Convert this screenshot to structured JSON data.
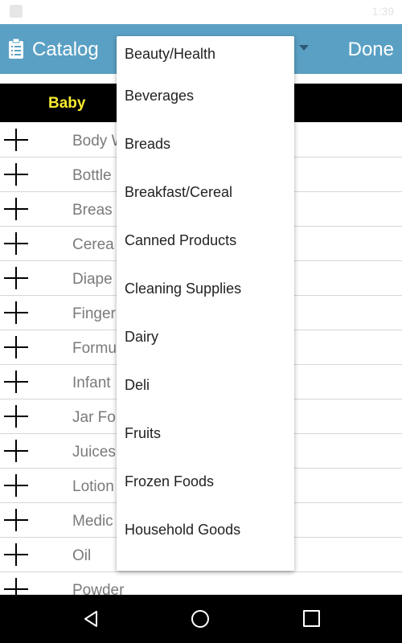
{
  "status_bar": {
    "right_text": "1:39"
  },
  "app_bar": {
    "title": "Catalog",
    "done_label": "Done"
  },
  "section": {
    "label": "Baby",
    "label_color": "#f7ea2f"
  },
  "list_items": [
    "Body W",
    "Bottle",
    "Breas",
    "Cerea",
    "Diape",
    "Finger",
    "Formu",
    "Infant",
    "Jar Fo",
    "Juices",
    "Lotion",
    "Medic",
    "Oil",
    "Powder"
  ],
  "dropdown": {
    "options": [
      "Beauty/Health",
      "Beverages",
      "Breads",
      "Breakfast/Cereal",
      "Canned Products",
      "Cleaning Supplies",
      "Dairy",
      "Deli",
      "Fruits",
      "Frozen Foods",
      "Household Goods"
    ]
  },
  "colors": {
    "app_bar": "#5aa0c4",
    "section_bg": "#000000",
    "nav_bg": "#000000"
  }
}
